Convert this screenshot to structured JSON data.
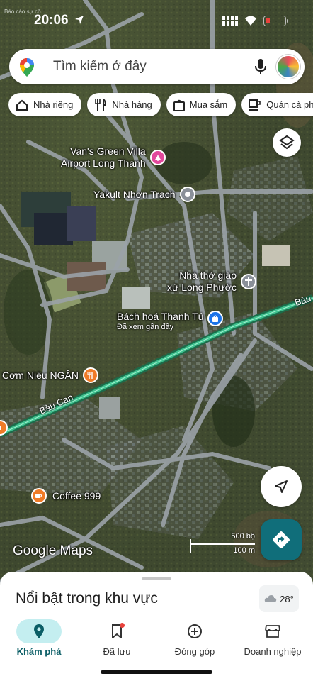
{
  "status_bar": {
    "time": "20:06",
    "legal_text": "Báo cáo sự cố",
    "battery_color": "#e8423c"
  },
  "search": {
    "placeholder": "Tìm kiếm ở đây"
  },
  "chips": [
    {
      "label": "Nhà riêng",
      "icon": "home-icon"
    },
    {
      "label": "Nhà hàng",
      "icon": "restaurant-icon"
    },
    {
      "label": "Mua sắm",
      "icon": "shopping-bag-icon"
    },
    {
      "label": "Quán cà phê",
      "icon": "coffee-icon"
    }
  ],
  "places": {
    "vans_green_villa": {
      "line1": "Van's Green Villa",
      "line2": "Airport Long Thanh",
      "color": "#e2489c"
    },
    "yakult": {
      "label": "Yakult Nhơn Trạch",
      "color": "#8a9099"
    },
    "nha_tho": {
      "line1": "Nhà thờ giáo",
      "line2": "xứ Long Phước",
      "color": "#8a9099"
    },
    "bach_hoa": {
      "label": "Bách hoá Thanh Tú",
      "sub": "Đã xem gần đây",
      "color": "#1a73e8"
    },
    "com_nieu": {
      "label": "Cơm Niêu NGÂN",
      "color": "#f07b27"
    },
    "coffee_999": {
      "label": "Coffee 999",
      "color": "#f07b27"
    }
  },
  "roads": {
    "bau_can_left": "Bàu Cạn",
    "bau_can_right": "Bàu"
  },
  "map": {
    "logo": "Google Maps",
    "scale_ft": "500 bộ",
    "scale_m": "100 m"
  },
  "sheet": {
    "title": "Nổi bật trong khu vực",
    "temperature": "28°"
  },
  "nav": [
    {
      "label": "Khám phá",
      "icon": "explore-pin-icon",
      "active": true
    },
    {
      "label": "Đã lưu",
      "icon": "bookmark-icon",
      "active": false
    },
    {
      "label": "Đóng góp",
      "icon": "add-circle-icon",
      "active": false
    },
    {
      "label": "Doanh nghiệp",
      "icon": "storefront-icon",
      "active": false
    }
  ],
  "colors": {
    "accent": "#106e7a",
    "active_nav_bg": "#c4eef0",
    "highlighted_road": "#3ec28f"
  }
}
